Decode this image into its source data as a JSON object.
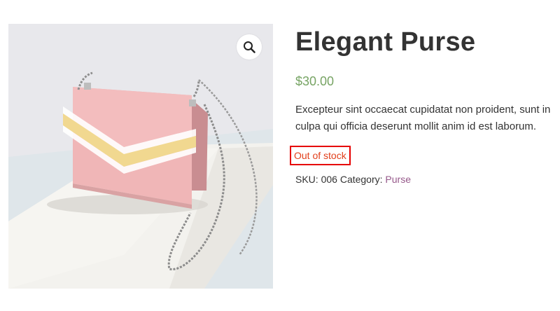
{
  "product": {
    "title": "Elegant Purse",
    "price": "$30.00",
    "description": "Excepteur sint occaecat cupidatat non proident, sunt in culpa qui officia deserunt mollit anim id est laborum.",
    "stock_status": "Out of stock",
    "sku_label": "SKU:",
    "sku": "006",
    "category_label": "Category:",
    "category": "Purse"
  },
  "gallery": {
    "zoom_icon": "magnifier-icon"
  },
  "colors": {
    "price": "#77a464",
    "stock": "#e2401c",
    "stock_highlight": "#e60000",
    "category_link": "#96588a",
    "text": "#333333"
  }
}
